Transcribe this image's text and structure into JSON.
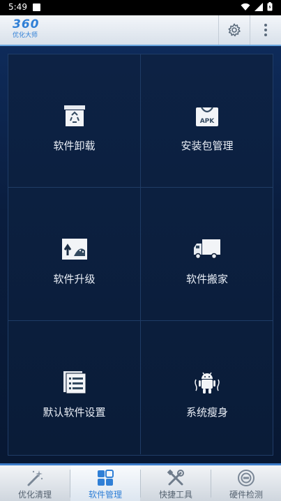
{
  "status_bar": {
    "time": "5:49",
    "icons": [
      "wifi-icon",
      "signal-icon",
      "battery-icon"
    ]
  },
  "app_bar": {
    "logo_number": "360",
    "logo_subtitle": "优化大师",
    "actions": [
      "gear-icon",
      "more-vertical-icon"
    ]
  },
  "grid": {
    "items": [
      {
        "label": "软件卸载",
        "icon": "recycle-bin-icon"
      },
      {
        "label": "安装包管理",
        "icon": "apk-package-icon"
      },
      {
        "label": "软件升级",
        "icon": "upgrade-android-icon"
      },
      {
        "label": "软件搬家",
        "icon": "truck-icon"
      },
      {
        "label": "默认软件设置",
        "icon": "list-document-icon"
      },
      {
        "label": "系统瘦身",
        "icon": "android-slim-icon"
      }
    ]
  },
  "bottom_nav": {
    "tabs": [
      {
        "label": "优化清理",
        "icon": "magic-wand-icon",
        "active": false
      },
      {
        "label": "软件管理",
        "icon": "app-grid-icon",
        "active": true
      },
      {
        "label": "快捷工具",
        "icon": "tools-icon",
        "active": false
      },
      {
        "label": "硬件检测",
        "icon": "hardware-check-icon",
        "active": false
      }
    ]
  },
  "colors": {
    "accent": "#2f7fd6",
    "background": "#0b1a33",
    "grid_border": "#1f3c66"
  }
}
